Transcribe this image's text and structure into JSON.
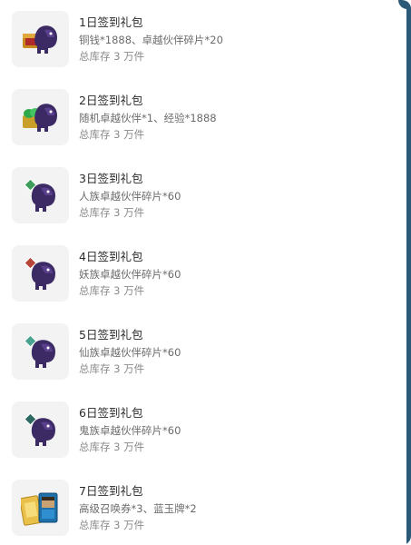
{
  "gift_list": {
    "items": [
      {
        "title": "1日签到礼包",
        "desc": "铜钱*1888、卓越伙伴碎片*20",
        "stock": "总库存 3 万件",
        "icon": "pet-with-gold-chest-icon",
        "gem_color": "#c0392b"
      },
      {
        "title": "2日签到礼包",
        "desc": "随机卓越伙伴*1、经验*1888",
        "stock": "总库存 3 万件",
        "icon": "pet-with-jade-chest-icon",
        "gem_color": "#2ea84a"
      },
      {
        "title": "3日签到礼包",
        "desc": "人族卓越伙伴碎片*60",
        "stock": "总库存 3 万件",
        "icon": "pet-shard-green-icon",
        "gem_color": "#3f9e5b"
      },
      {
        "title": "4日签到礼包",
        "desc": "妖族卓越伙伴碎片*60",
        "stock": "总库存 3 万件",
        "icon": "pet-shard-red-icon",
        "gem_color": "#b8453a"
      },
      {
        "title": "5日签到礼包",
        "desc": "仙族卓越伙伴碎片*60",
        "stock": "总库存 3 万件",
        "icon": "pet-shard-teal-icon",
        "gem_color": "#4aa38e"
      },
      {
        "title": "6日签到礼包",
        "desc": "鬼族卓越伙伴碎片*60",
        "stock": "总库存 3 万件",
        "icon": "pet-shard-dark-icon",
        "gem_color": "#2f6a62"
      },
      {
        "title": "7日签到礼包",
        "desc": "高级召唤券*3、蓝玉牌*2",
        "stock": "总库存 3 万件",
        "icon": "summon-ticket-and-jade-card-icon",
        "gem_color": "#e0b23a"
      }
    ]
  },
  "colors": {
    "pet_body": "#3b2a63",
    "pet_shade": "#5a3f8c",
    "window_edge": "#2b5a78"
  }
}
